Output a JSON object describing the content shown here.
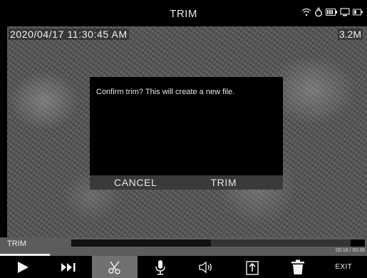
{
  "header": {
    "title": "TRIM"
  },
  "status_icons": [
    "wifi-icon",
    "ring-icon",
    "battery-icon",
    "monitor-icon",
    "power-icon"
  ],
  "overlay": {
    "timestamp": "2020/04/17 11:30:45 AM",
    "resolution": "3.2M"
  },
  "dialog": {
    "message": "Confirm trim? This will create a new file.",
    "cancel_label": "CANCEL",
    "confirm_label": "TRIM"
  },
  "trim_bar": {
    "label": "TRIM",
    "time": "00:18 / 00:36",
    "progress_fraction": 0.5
  },
  "toolbar": {
    "items": [
      {
        "icon": "play-icon",
        "active": false
      },
      {
        "icon": "skip-forward-icon",
        "active": false
      },
      {
        "icon": "scissors-icon",
        "active": true
      },
      {
        "icon": "microphone-icon",
        "active": false
      },
      {
        "icon": "speaker-icon",
        "active": false
      },
      {
        "icon": "export-icon",
        "active": false
      },
      {
        "icon": "trash-icon",
        "active": false
      }
    ],
    "exit_label": "EXIT"
  },
  "colors": {
    "accent_active": "#707070",
    "trim_bar": "#5c5c5c",
    "dialog_bar": "#3a3a3a"
  }
}
